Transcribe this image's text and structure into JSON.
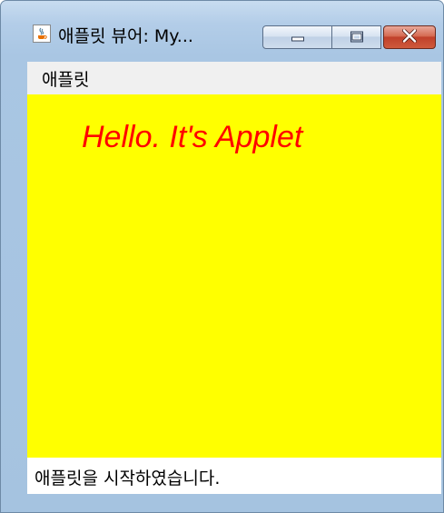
{
  "window": {
    "title": "애플릿 뷰어: My...",
    "icon": "java-cup-icon"
  },
  "caption_buttons": {
    "minimize": "minimize-icon",
    "maximize": "maximize-icon",
    "close": "close-icon"
  },
  "menu": {
    "applet_label": "애플릿"
  },
  "applet": {
    "text": "Hello. It's Applet",
    "background": "#ffff00",
    "text_color": "#ff0000"
  },
  "status": {
    "text": "애플릿을 시작하였습니다."
  }
}
